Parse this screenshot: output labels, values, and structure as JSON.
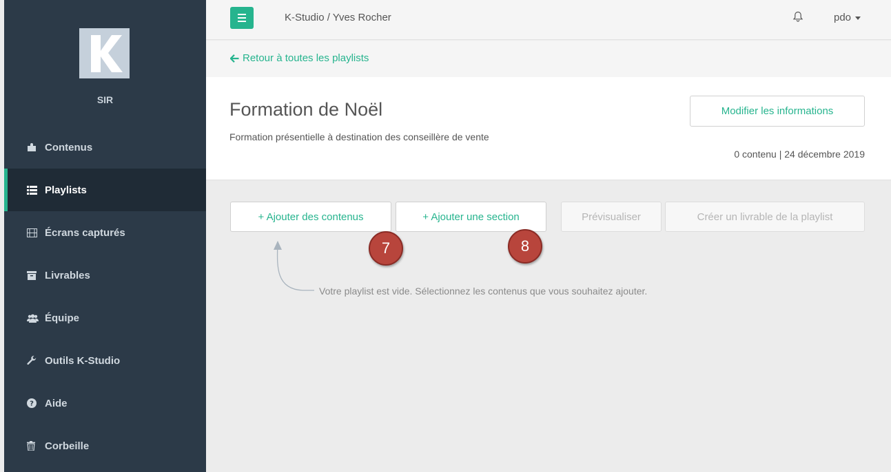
{
  "sidebar": {
    "logo_letter": "K",
    "org_name": "SIR",
    "items": [
      {
        "label": "Contenus",
        "icon": "puzzle-icon"
      },
      {
        "label": "Playlists",
        "icon": "list-icon"
      },
      {
        "label": "Écrans capturés",
        "icon": "film-icon"
      },
      {
        "label": "Livrables",
        "icon": "archive-icon"
      },
      {
        "label": "Équipe",
        "icon": "users-icon"
      },
      {
        "label": "Outils K-Studio",
        "icon": "wrench-icon"
      },
      {
        "label": "Aide",
        "icon": "question-circle-icon"
      },
      {
        "label": "Corbeille",
        "icon": "trash-icon"
      }
    ],
    "active_item": "Playlists"
  },
  "topbar": {
    "breadcrumb": "K-Studio / Yves Rocher",
    "username": "pdo"
  },
  "back_link": "Retour à toutes les playlists",
  "playlist": {
    "title": "Formation de Noël",
    "description": "Formation présentielle à destination des conseillère de vente",
    "edit_label": "Modifier les informations",
    "meta": "0 contenu | 24 décembre 2019"
  },
  "actions": {
    "add_content": "+ Ajouter des contenus",
    "add_section": "+ Ajouter une section",
    "preview": "Prévisualiser",
    "create_deliverable": "Créer un livrable de la playlist"
  },
  "annotations": {
    "step_a": "7",
    "step_b": "8"
  },
  "empty_hint": "Votre playlist est vide. Sélectionnez les contenus que vous souhaitez ajouter.",
  "colors": {
    "accent": "#26b48e",
    "sidebar_bg": "#2c3a48",
    "sidebar_active_bg": "#1f2b36",
    "callout": "#b8453c"
  }
}
